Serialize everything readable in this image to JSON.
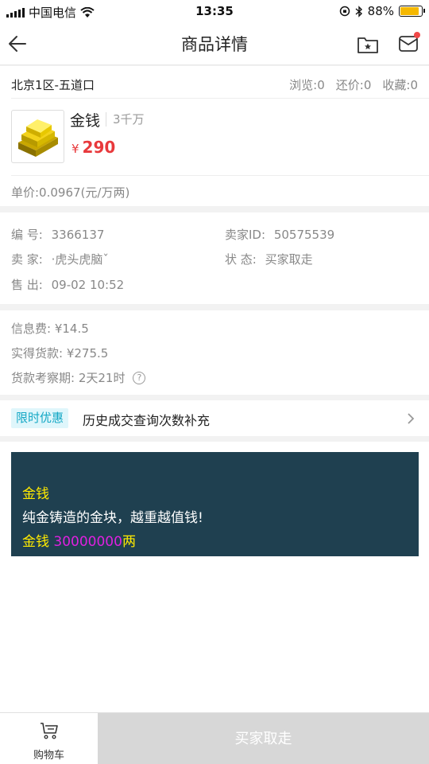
{
  "status_bar": {
    "carrier": "中国电信",
    "time": "13:35",
    "battery": "88%"
  },
  "nav": {
    "title": "商品详情"
  },
  "listing": {
    "region": "北京1区-五道口",
    "views": "浏览:0",
    "bargains": "还价:0",
    "favorites": "收藏:0",
    "product_name": "金钱",
    "quantity": "3千万",
    "currency_symbol": "¥",
    "price": "290",
    "unit_price": "单价:0.0967(元/万两)"
  },
  "details": {
    "number_label": "编 号:",
    "number_value": "3366137",
    "seller_label": "卖 家:",
    "seller_value": "·虎头虎脑ˇ",
    "sold_label": "售 出:",
    "sold_value": "09-02 10:52",
    "seller_id_label": "卖家ID:",
    "seller_id_value": "50575539",
    "status_label": "状 态:",
    "status_value": "买家取走"
  },
  "fees": {
    "info_fee": "信息费: ¥14.5",
    "received": "实得货款: ¥275.5",
    "inspection": "货款考察期: 2天21时",
    "help_icon_glyph": "?"
  },
  "promo": {
    "badge": "限时优惠",
    "label": "历史成交查询次数补充"
  },
  "description": {
    "line1": "金钱",
    "line2": "纯金铸造的金块，越重越值钱!",
    "line3_a": "金钱 ",
    "line3_b": "30000000",
    "line3_c": "两"
  },
  "bottom": {
    "cart_label": "购物车",
    "action_label": "买家取走"
  },
  "colors": {
    "price": "#e8393c",
    "desc_bg": "#1f4050",
    "badge_bg": "#dff6fb",
    "badge_text": "#15a8c5"
  }
}
